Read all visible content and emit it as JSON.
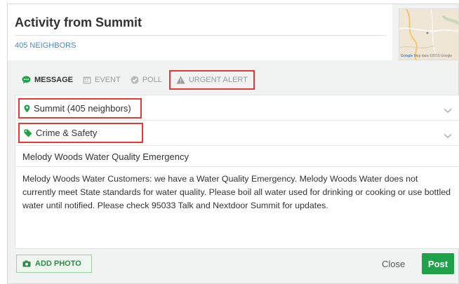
{
  "header": {
    "title": "Activity from Summit",
    "neighbors_link": "405 NEIGHBORS"
  },
  "map": {
    "attribution_brand": "Google",
    "attribution_text": "Map data ©2015 Google"
  },
  "tabs": [
    {
      "label": "MESSAGE",
      "icon": "chat-bubble-icon",
      "active": true
    },
    {
      "label": "EVENT",
      "icon": "calendar-icon",
      "active": false
    },
    {
      "label": "POLL",
      "icon": "check-circle-icon",
      "active": false
    },
    {
      "label": "URGENT ALERT",
      "icon": "warning-triangle-icon",
      "active": false
    }
  ],
  "form": {
    "location_value": "Summit (405 neighbors)",
    "category_value": "Crime & Safety",
    "subject_value": "Melody Woods Water Quality Emergency",
    "message_value": "Melody Woods Water Customers: we have a Water Quality Emergency. Melody Woods Water does not currently meet State standards for water quality. Please boil all water used for drinking or cooking or use bottled water until notified. Please check 95033 Talk and Nextdoor Summit for updates."
  },
  "footer": {
    "add_photo_label": "ADD PHOTO",
    "close_label": "Close",
    "post_label": "Post"
  },
  "colors": {
    "accent_green": "#1ea24a",
    "link_blue": "#4a8ac9",
    "highlight_red": "#e53935"
  }
}
